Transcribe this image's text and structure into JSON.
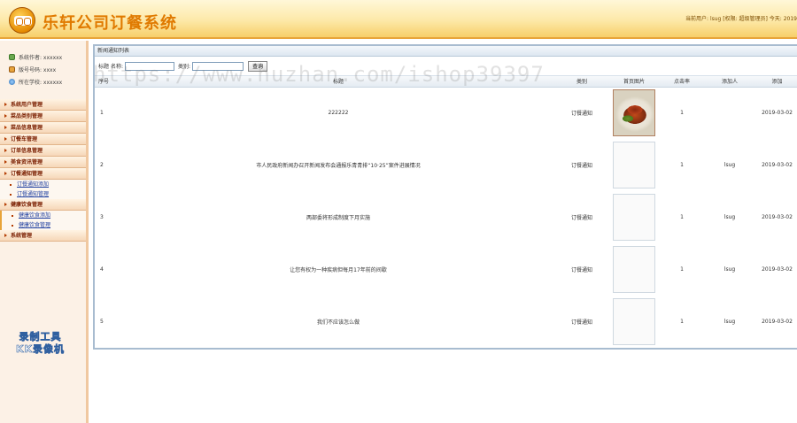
{
  "header": {
    "app_title": "乐轩公司订餐系统",
    "user_info": "当前用户: lsug [权限: 超级管理员]  今天: 2019"
  },
  "sidebar": {
    "info": [
      {
        "icon": "home-icon",
        "label": "系统作者: xxxxxx"
      },
      {
        "icon": "id-card-icon",
        "label": "版号号码: xxxx"
      },
      {
        "icon": "globe-icon",
        "label": "所在学校: xxxxxx"
      }
    ],
    "menu": [
      {
        "label": "系统用户管理",
        "children": []
      },
      {
        "label": "菜品类别管理",
        "children": []
      },
      {
        "label": "菜品信息管理",
        "children": []
      },
      {
        "label": "订餐车管理",
        "children": []
      },
      {
        "label": "订单信息管理",
        "children": []
      },
      {
        "label": "美食资讯管理",
        "children": []
      },
      {
        "label": "订餐通知管理",
        "children": [
          "订餐通知添加",
          "订餐通知管理"
        ]
      },
      {
        "label": "健康饮食管理",
        "children": [
          "健康饮食添加",
          "健康饮食管理"
        ]
      },
      {
        "label": "系统管理",
        "children": []
      }
    ],
    "badge_line1": "录制工具",
    "badge_line2": "KK录像机"
  },
  "main": {
    "panel_title": "新闻通知列表",
    "search": {
      "title_label": "标题",
      "name_label": "名称:",
      "name_value": "",
      "category_label": "类别:",
      "category_value": "",
      "button_label": "查询"
    },
    "columns": [
      "序号",
      "标题",
      "类别",
      "首页图片",
      "点击率",
      "添加人",
      "添加"
    ],
    "rows": [
      {
        "no": "1",
        "title": "222222",
        "category": "订餐通知",
        "has_image": true,
        "clicks": "1",
        "added_by": "",
        "date": "2019-03-02"
      },
      {
        "no": "2",
        "title": "市人民政府新闻办召开新闻发布会通报乐青青排“10·25”案件进展情况",
        "category": "订餐通知",
        "has_image": false,
        "clicks": "1",
        "added_by": "lsug",
        "date": "2019-03-02"
      },
      {
        "no": "3",
        "title": "两部委将形成制度下月实施",
        "category": "订餐通知",
        "has_image": false,
        "clicks": "1",
        "added_by": "lsug",
        "date": "2019-03-02"
      },
      {
        "no": "4",
        "title": "让您有权为一种疾病但每月17年前的间歇",
        "category": "订餐通知",
        "has_image": false,
        "clicks": "1",
        "added_by": "lsug",
        "date": "2019-03-02"
      },
      {
        "no": "5",
        "title": "我们不应该怎么做",
        "category": "订餐通知",
        "has_image": false,
        "clicks": "1",
        "added_by": "lsug",
        "date": "2019-03-02"
      }
    ]
  },
  "watermark": "https://www.huzhan.com/ishop39397"
}
